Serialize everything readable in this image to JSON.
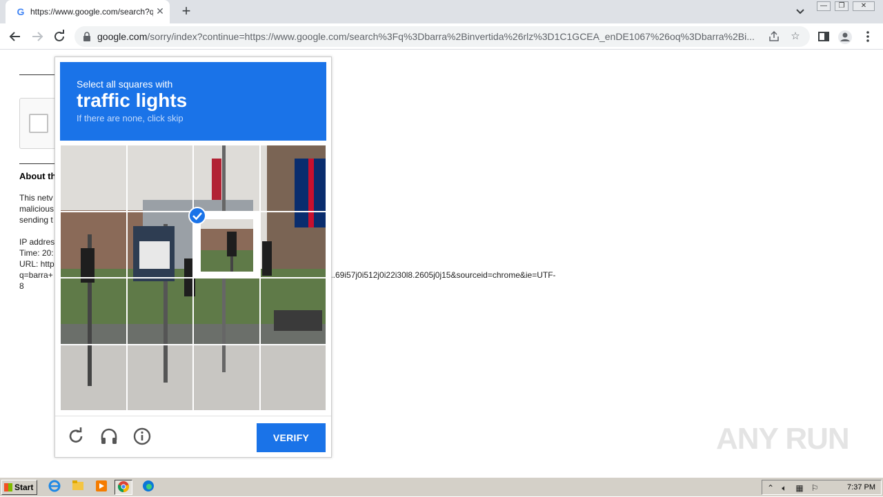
{
  "browser": {
    "tab": {
      "title": "https://www.google.com/search?q=",
      "favicon": "G",
      "close": "✕"
    },
    "new_tab": "+",
    "window_controls": [
      "minimize",
      "restore",
      "close"
    ],
    "address": {
      "host": "google.com",
      "path": "/sorry/index?continue=https://www.google.com/search%3Fq%3Dbarra%2Binvertida%26rlz%3D1C1GCEA_enDE1067%26oq%3Dbarra%2Bi..."
    }
  },
  "page": {
    "about_heading": "About th",
    "body_lines": [
      "This netv",
      "malicious",
      "sending t",
      "",
      "IP addres",
      "Time: 20:",
      "URL: http",
      "q=barra+",
      "8"
    ],
    "url_tail": "...69i57j0i512j0i22i30l8.2605j0j15&sourceid=chrome&ie=UTF-"
  },
  "captcha": {
    "instruction": "Select all squares with",
    "target": "traffic lights",
    "hint": "If there are none, click skip",
    "selected_tiles": [
      6
    ],
    "verify_label": "VERIFY",
    "footer_icons": [
      "reload-icon",
      "audio-icon",
      "info-icon"
    ]
  },
  "watermark": "ANY RUN",
  "taskbar": {
    "start_label": "Start",
    "apps": [
      "internet-explorer-icon",
      "explorer-icon",
      "media-player-icon",
      "chrome-icon",
      "edge-icon"
    ],
    "clock": "7:37 PM"
  },
  "colors": {
    "accent": "#1a73e8",
    "tabstrip": "#dee1e6",
    "taskbar": "#d4d0c8"
  }
}
